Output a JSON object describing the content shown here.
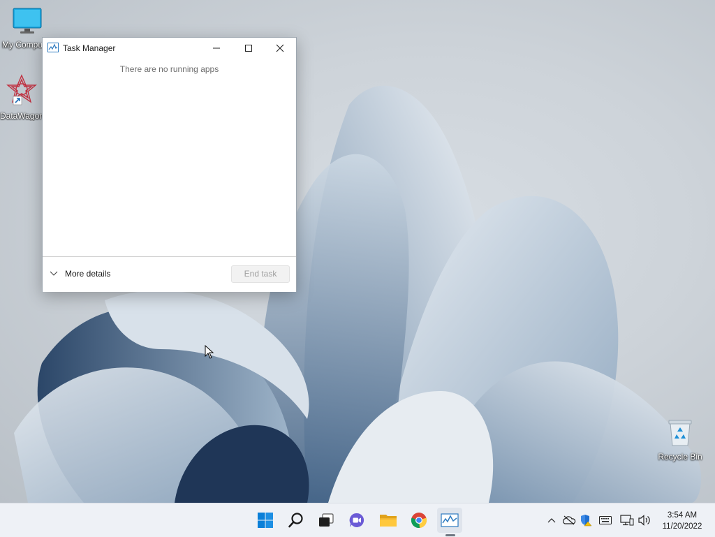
{
  "desktop": {
    "icons": [
      {
        "label": "My Computer",
        "icon": "monitor-icon"
      },
      {
        "label": "DataWagon",
        "icon": "datawagon-app-icon"
      },
      {
        "label": "Recycle Bin",
        "icon": "recycle-bin-icon"
      }
    ]
  },
  "task_manager": {
    "title": "Task Manager",
    "empty_message": "There are no running apps",
    "more_details_label": "More details",
    "end_task_label": "End task",
    "controls": [
      "minimize-icon",
      "maximize-icon",
      "close-icon"
    ]
  },
  "taskbar": {
    "pinned": [
      {
        "name": "start",
        "icon": "windows-logo-icon"
      },
      {
        "name": "search",
        "icon": "search-icon"
      },
      {
        "name": "task-view",
        "icon": "task-view-icon"
      },
      {
        "name": "chat",
        "icon": "chat-icon"
      },
      {
        "name": "file-explorer",
        "icon": "folder-icon"
      },
      {
        "name": "chrome",
        "icon": "chrome-icon"
      },
      {
        "name": "task-manager",
        "icon": "task-manager-icon",
        "active": true
      }
    ],
    "tray": [
      "chevron-up-icon",
      "onedrive-icon",
      "defender-icon",
      "keyboard-icon",
      "network-icon",
      "volume-icon"
    ],
    "clock": {
      "time": "3:54 AM",
      "date": "11/20/2022"
    }
  },
  "colors": {
    "accent": "#0067c0",
    "taskbar_bg": "#eef1f6",
    "wallpaper_blue": "#7e9ab5"
  }
}
